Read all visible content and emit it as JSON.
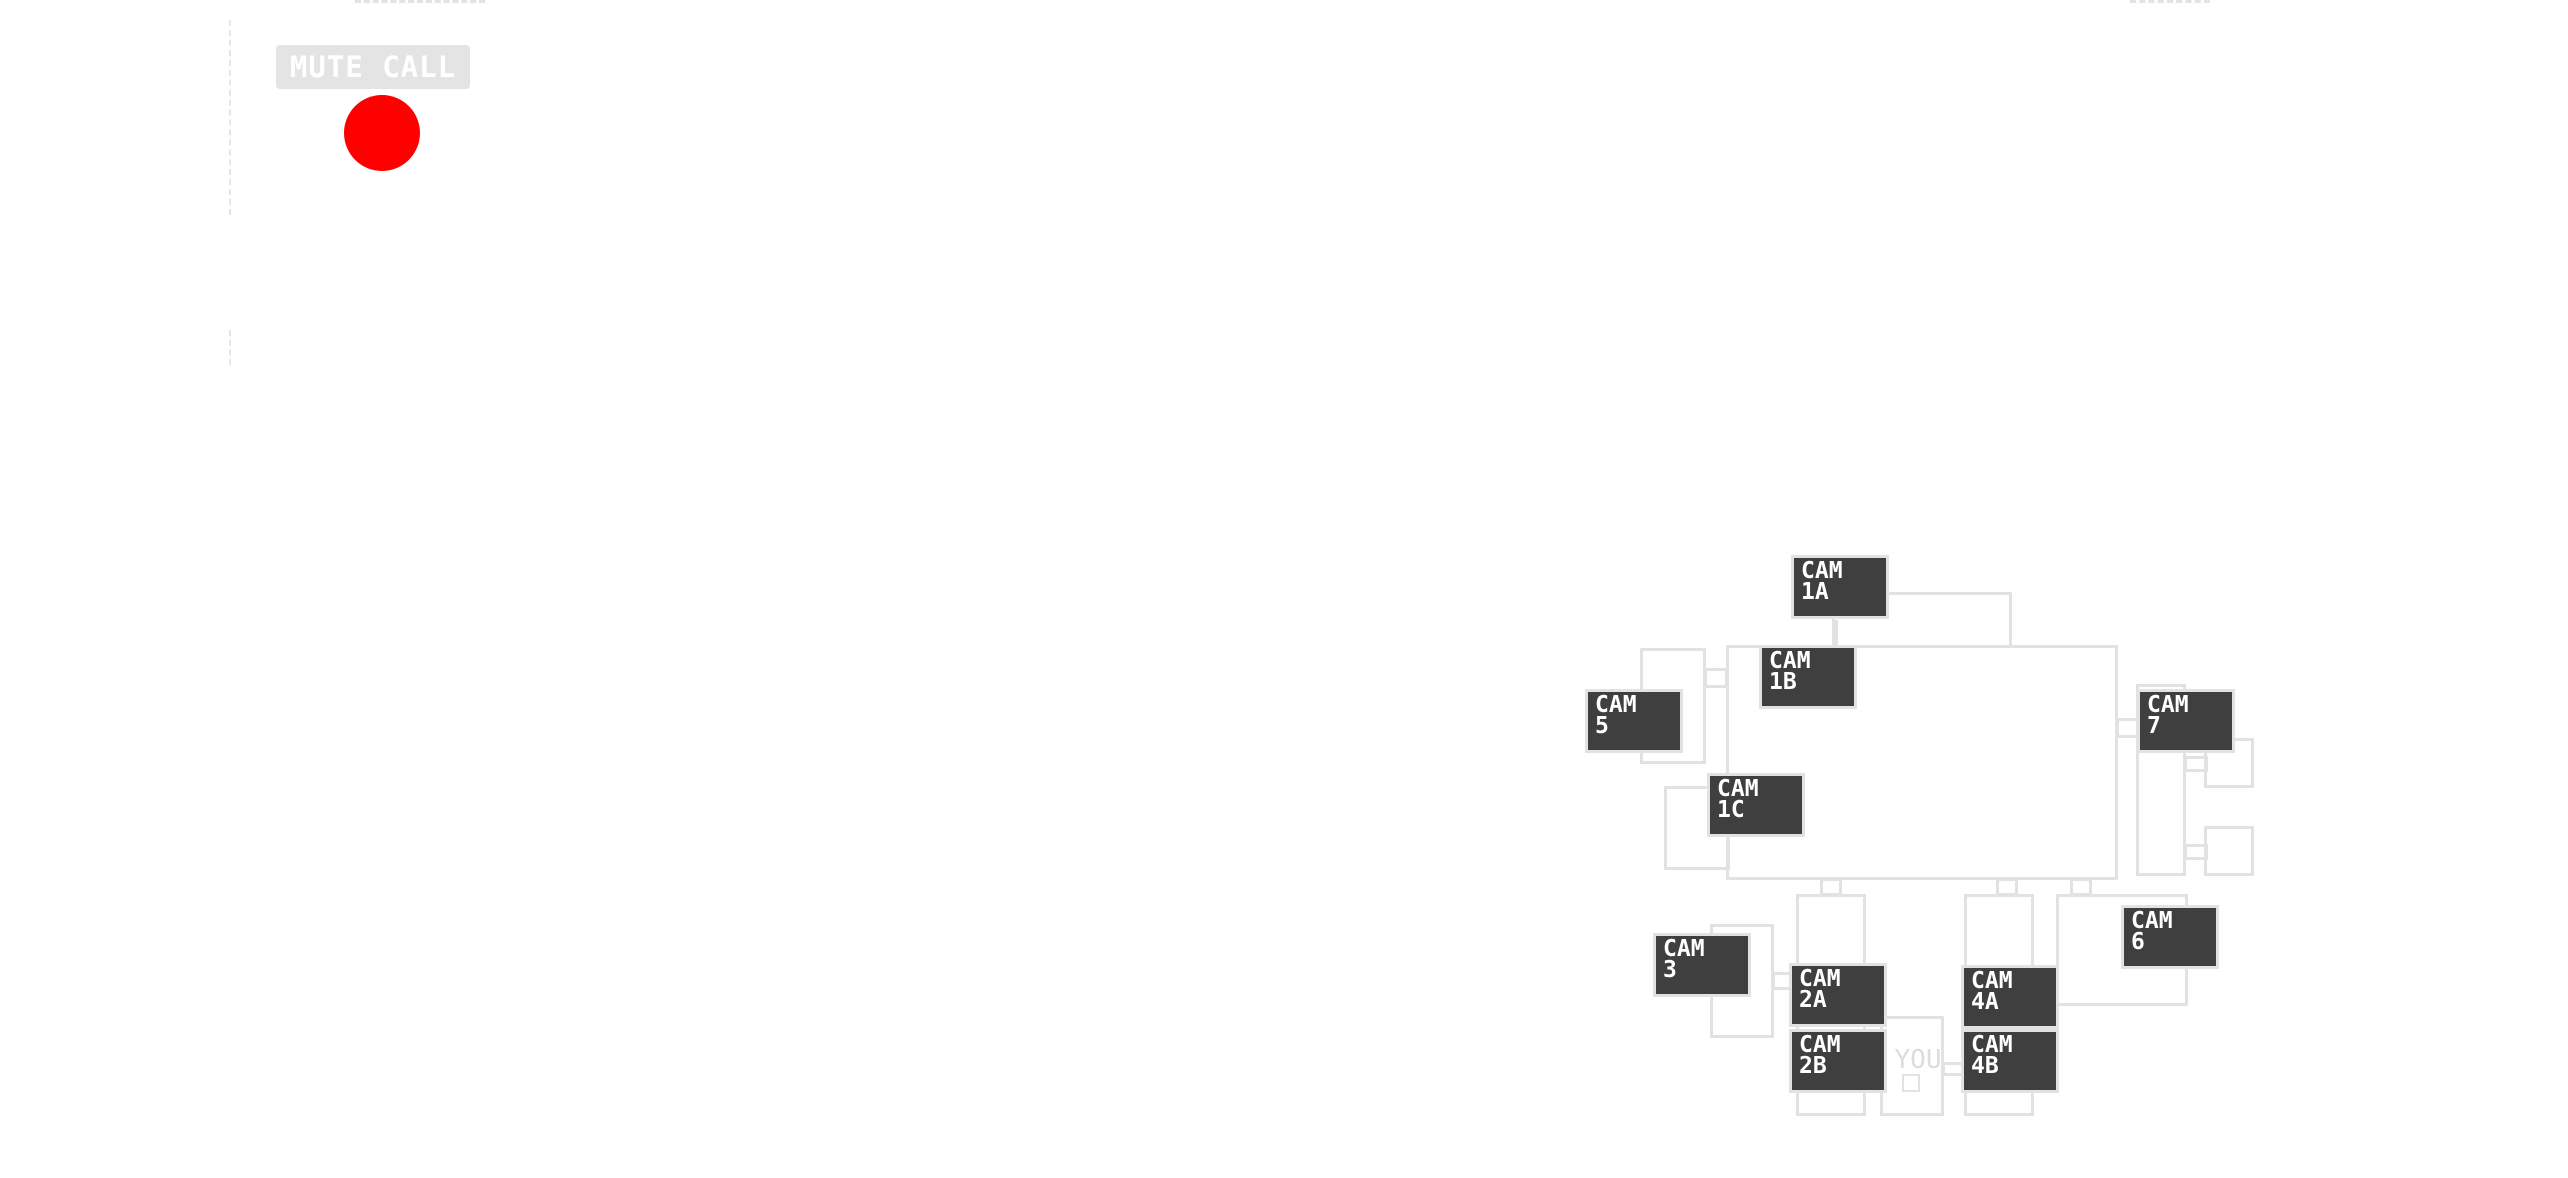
{
  "call": {
    "mute_label": "MUTE CALL"
  },
  "map": {
    "you_label": "YOU",
    "cameras": [
      {
        "id": "1A",
        "label": "CAM\n1A"
      },
      {
        "id": "1B",
        "label": "CAM\n1B"
      },
      {
        "id": "1C",
        "label": "CAM\n1C"
      },
      {
        "id": "5",
        "label": "CAM\n5"
      },
      {
        "id": "7",
        "label": "CAM\n7"
      },
      {
        "id": "3",
        "label": "CAM\n3"
      },
      {
        "id": "2A",
        "label": "CAM\n2A"
      },
      {
        "id": "2B",
        "label": "CAM\n2B"
      },
      {
        "id": "4A",
        "label": "CAM\n4A"
      },
      {
        "id": "4B",
        "label": "CAM\n4B"
      },
      {
        "id": "6",
        "label": "CAM\n6"
      }
    ]
  },
  "colors": {
    "record_indicator": "#ff0000",
    "camera_button": "#3f3f3f",
    "map_walls": "#e2e2e2"
  }
}
